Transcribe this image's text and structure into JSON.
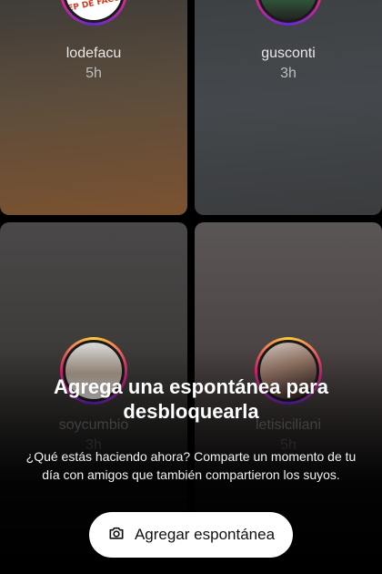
{
  "stories": [
    {
      "username": "lodefacu",
      "time": "5h",
      "avatar": "logo-avatar",
      "logo_text": "EP DE FACU"
    },
    {
      "username": "gusconti",
      "time": "3h",
      "avatar": "photo-avatar"
    },
    {
      "username": "soycumbio",
      "time": "3h",
      "avatar": "photo-avatar"
    },
    {
      "username": "letisiciliani",
      "time": "5h",
      "avatar": "photo-avatar"
    }
  ],
  "prompt": {
    "title": "Agrega una espontánea para desbloquearla",
    "description": "¿Qué estás haciendo ahora? Comparte un momento de tu día con amigos que también compartieron los suyos."
  },
  "cta": {
    "label": "Agregar espontánea",
    "icon": "camera-icon"
  },
  "colors": {
    "ring": "#ee2a7b",
    "button_bg": "#ffffff",
    "background": "#000000"
  }
}
